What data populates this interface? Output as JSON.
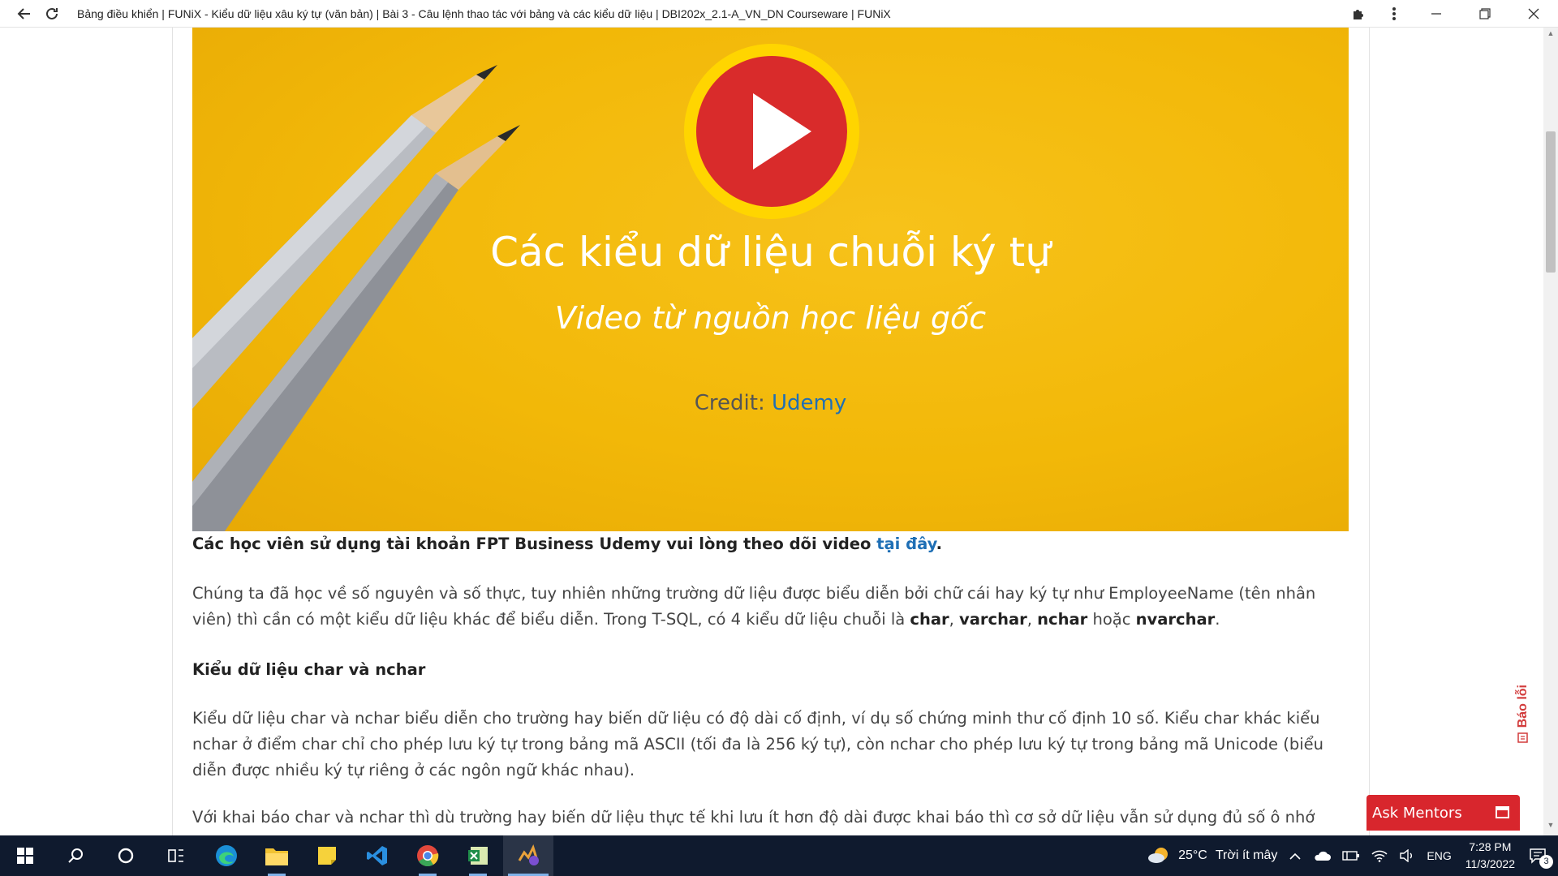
{
  "browser": {
    "title": "Bảng điều khiển | FUNiX - Kiểu dữ liệu xâu ký tự (văn bản) | Bài 3 - Câu lệnh thao tác với bảng và các kiểu dữ liệu | DBI202x_2.1-A_VN_DN Courseware | FUNiX"
  },
  "hero": {
    "title": "Các kiểu dữ liệu chuỗi ký tự",
    "subtitle": "Video từ nguồn học liệu gốc",
    "credit_label": "Credit:",
    "credit_link": "Udemy",
    "play_color": "#d92b2b",
    "ring_color": "#ffd500",
    "background": "#f2b808"
  },
  "article": {
    "p1_text": "Các học viên sử dụng tài khoản FPT Business Udemy vui lòng theo dõi video",
    "p1_link": "tại đây",
    "p1_end": ".",
    "p2_a": "Chúng ta đã học về số nguyên và số thực, tuy nhiên những trường dữ liệu được biểu diễn bởi chữ cái hay ký tự như EmployeeName (tên nhân viên) thì cần có một kiểu dữ liệu khác để biểu diễn. Trong T-SQL, có 4 kiểu dữ liệu chuỗi là",
    "type_char": "char",
    "type_varchar": "varchar",
    "type_nchar": "nchar",
    "or_text": "hoặc",
    "type_nvarchar": "nvarchar",
    "comma": ",",
    "period": ".",
    "heading": "Kiểu dữ liệu char và nchar",
    "p3": "Kiểu dữ liệu char và nchar biểu diễn cho trường hay biến dữ liệu có độ dài cố định, ví dụ số chứng minh thư cố định 10 số. Kiểu char khác kiểu nchar ở điểm char chỉ cho phép lưu ký tự trong bảng mã ASCII (tối đa là 256 ký tự), còn nchar cho phép lưu ký tự trong bảng mã Unicode (biểu diễn được nhiều ký tự riêng ở các ngôn ngữ khác nhau).",
    "p4": "Với khai báo char và nchar thì dù trường hay biến dữ liệu thực tế khi lưu ít hơn độ dài được khai báo thì cơ sở dữ liệu vẫn sử dụng đủ số ô nhớ tương ứng"
  },
  "widgets": {
    "report_label": "Báo lỗi",
    "ask_mentors": "Ask Mentors"
  },
  "taskbar": {
    "weather_temp": "25°C",
    "weather_text": "Trời ít mây",
    "language": "ENG",
    "time": "7:28 PM",
    "date": "11/3/2022",
    "notification_count": "3",
    "apps": [
      "start",
      "search",
      "cortana",
      "task-view",
      "edge",
      "file-explorer",
      "sticky-notes",
      "vscode",
      "chrome",
      "excel",
      "tracker"
    ]
  }
}
